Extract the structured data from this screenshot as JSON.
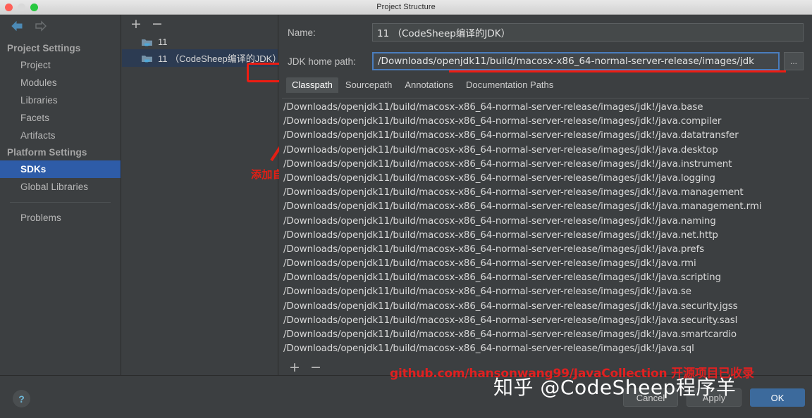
{
  "window": {
    "title": "Project Structure",
    "traffic_lights": [
      "close",
      "minimize",
      "zoom"
    ]
  },
  "nav": {
    "back_icon": "arrow-left-icon",
    "forward_icon": "arrow-right-icon"
  },
  "sidebar": {
    "groups": [
      {
        "label": "Project Settings",
        "items": [
          {
            "label": "Project",
            "selected": false
          },
          {
            "label": "Modules",
            "selected": false
          },
          {
            "label": "Libraries",
            "selected": false
          },
          {
            "label": "Facets",
            "selected": false
          },
          {
            "label": "Artifacts",
            "selected": false
          }
        ]
      },
      {
        "label": "Platform Settings",
        "items": [
          {
            "label": "SDKs",
            "selected": true
          },
          {
            "label": "Global Libraries",
            "selected": false
          }
        ]
      }
    ],
    "extra": [
      {
        "label": "Problems",
        "selected": false
      }
    ]
  },
  "tree": {
    "toolbar": {
      "add_label": "+",
      "remove_label": "−"
    },
    "items": [
      {
        "label": "11",
        "selected": false,
        "icon": "jdk-folder-icon"
      },
      {
        "label": "11 （CodeSheep编译的JDK）",
        "selected": true,
        "icon": "jdk-folder-icon"
      }
    ],
    "annotation": "添加自行编译的JDK",
    "highlight_color": "#ee1c12"
  },
  "detail": {
    "name_label": "Name:",
    "name_value": "11 （CodeSheep编译的JDK）",
    "home_label": "JDK home path:",
    "home_value": "/Downloads/openjdk11/build/macosx-x86_64-normal-server-release/images/jdk",
    "browse_label": "...",
    "tabs": [
      {
        "label": "Classpath",
        "active": true
      },
      {
        "label": "Sourcepath",
        "active": false
      },
      {
        "label": "Annotations",
        "active": false
      },
      {
        "label": "Documentation Paths",
        "active": false
      }
    ],
    "classpath_entries": [
      "/Downloads/openjdk11/build/macosx-x86_64-normal-server-release/images/jdk!/java.base",
      "/Downloads/openjdk11/build/macosx-x86_64-normal-server-release/images/jdk!/java.compiler",
      "/Downloads/openjdk11/build/macosx-x86_64-normal-server-release/images/jdk!/java.datatransfer",
      "/Downloads/openjdk11/build/macosx-x86_64-normal-server-release/images/jdk!/java.desktop",
      "/Downloads/openjdk11/build/macosx-x86_64-normal-server-release/images/jdk!/java.instrument",
      "/Downloads/openjdk11/build/macosx-x86_64-normal-server-release/images/jdk!/java.logging",
      "/Downloads/openjdk11/build/macosx-x86_64-normal-server-release/images/jdk!/java.management",
      "/Downloads/openjdk11/build/macosx-x86_64-normal-server-release/images/jdk!/java.management.rmi",
      "/Downloads/openjdk11/build/macosx-x86_64-normal-server-release/images/jdk!/java.naming",
      "/Downloads/openjdk11/build/macosx-x86_64-normal-server-release/images/jdk!/java.net.http",
      "/Downloads/openjdk11/build/macosx-x86_64-normal-server-release/images/jdk!/java.prefs",
      "/Downloads/openjdk11/build/macosx-x86_64-normal-server-release/images/jdk!/java.rmi",
      "/Downloads/openjdk11/build/macosx-x86_64-normal-server-release/images/jdk!/java.scripting",
      "/Downloads/openjdk11/build/macosx-x86_64-normal-server-release/images/jdk!/java.se",
      "/Downloads/openjdk11/build/macosx-x86_64-normal-server-release/images/jdk!/java.security.jgss",
      "/Downloads/openjdk11/build/macosx-x86_64-normal-server-release/images/jdk!/java.security.sasl",
      "/Downloads/openjdk11/build/macosx-x86_64-normal-server-release/images/jdk!/java.smartcardio",
      "/Downloads/openjdk11/build/macosx-x86_64-normal-server-release/images/jdk!/java.sql"
    ],
    "list_toolbar": {
      "add_label": "+",
      "remove_label": "−"
    }
  },
  "footer": {
    "help_label": "?",
    "cancel_label": "Cancel",
    "apply_label": "Apply",
    "ok_label": "OK",
    "ok_color": "#3c6a9c"
  },
  "watermarks": {
    "red": "github.com/hansonwang99/JavaCollection 开源项目已收录",
    "white": "知乎 @CodeSheep程序羊"
  }
}
